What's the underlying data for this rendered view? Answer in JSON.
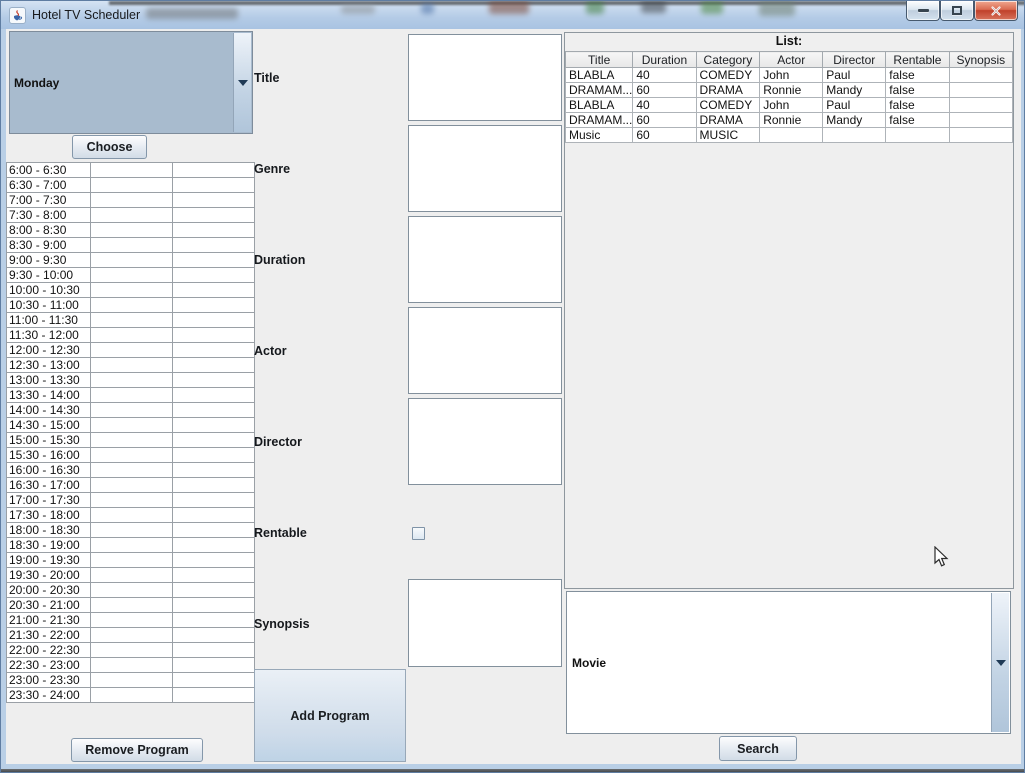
{
  "window": {
    "title": "Hotel TV Scheduler"
  },
  "day_selector": {
    "selected": "Monday",
    "choose_button": "Choose"
  },
  "schedule": {
    "time_slots": [
      "6:00 - 6:30",
      "6:30 - 7:00",
      "7:00 - 7:30",
      "7:30 - 8:00",
      "8:00 - 8:30",
      "8:30 - 9:00",
      "9:00 - 9:30",
      "9:30 - 10:00",
      "10:00 - 10:30",
      "10:30 - 11:00",
      "11:00 - 11:30",
      "11:30 - 12:00",
      "12:00 - 12:30",
      "12:30 - 13:00",
      "13:00 - 13:30",
      "13:30 - 14:00",
      "14:00 - 14:30",
      "14:30 - 15:00",
      "15:00 - 15:30",
      "15:30 - 16:00",
      "16:00 - 16:30",
      "16:30 - 17:00",
      "17:00 - 17:30",
      "17:30 - 18:00",
      "18:00 - 18:30",
      "18:30 - 19:00",
      "19:00 - 19:30",
      "19:30 - 20:00",
      "20:00 - 20:30",
      "20:30 - 21:00",
      "21:00 - 21:30",
      "21:30 - 22:00",
      "22:00 - 22:30",
      "22:30 - 23:00",
      "23:00 - 23:30",
      "23:30 - 24:00"
    ],
    "remove_button": "Remove Program"
  },
  "form": {
    "labels": {
      "title": "Title",
      "genre": "Genre",
      "duration": "Duration",
      "actor": "Actor",
      "director": "Director",
      "rentable": "Rentable",
      "synopsis": "Synopsis"
    },
    "values": {
      "title": "",
      "genre": "",
      "duration": "",
      "actor": "",
      "director": "",
      "synopsis": ""
    },
    "rentable_checked": false,
    "add_button": "Add Program"
  },
  "list_panel": {
    "caption": "List:",
    "columns": [
      "Title",
      "Duration",
      "Category",
      "Actor",
      "Director",
      "Rentable",
      "Synopsis"
    ],
    "rows": [
      [
        "BLABLA",
        "40",
        "COMEDY",
        "John",
        "Paul",
        "false",
        ""
      ],
      [
        "DRAMAM...",
        "60",
        "DRAMA",
        "Ronnie",
        "Mandy",
        "false",
        ""
      ],
      [
        "BLABLA",
        "40",
        "COMEDY",
        "John",
        "Paul",
        "false",
        ""
      ],
      [
        "DRAMAM...",
        "60",
        "DRAMA",
        "Ronnie",
        "Mandy",
        "false",
        ""
      ],
      [
        "Music",
        "60",
        "MUSIC",
        "",
        "",
        "",
        ""
      ]
    ]
  },
  "search_panel": {
    "selected": "Movie",
    "search_button": "Search"
  },
  "colors": {
    "titlebar": "#b4cbe6",
    "close_button": "#c0402a",
    "combo_selected_bg": "#a8bbce",
    "panel_bg": "#eeeeee"
  }
}
